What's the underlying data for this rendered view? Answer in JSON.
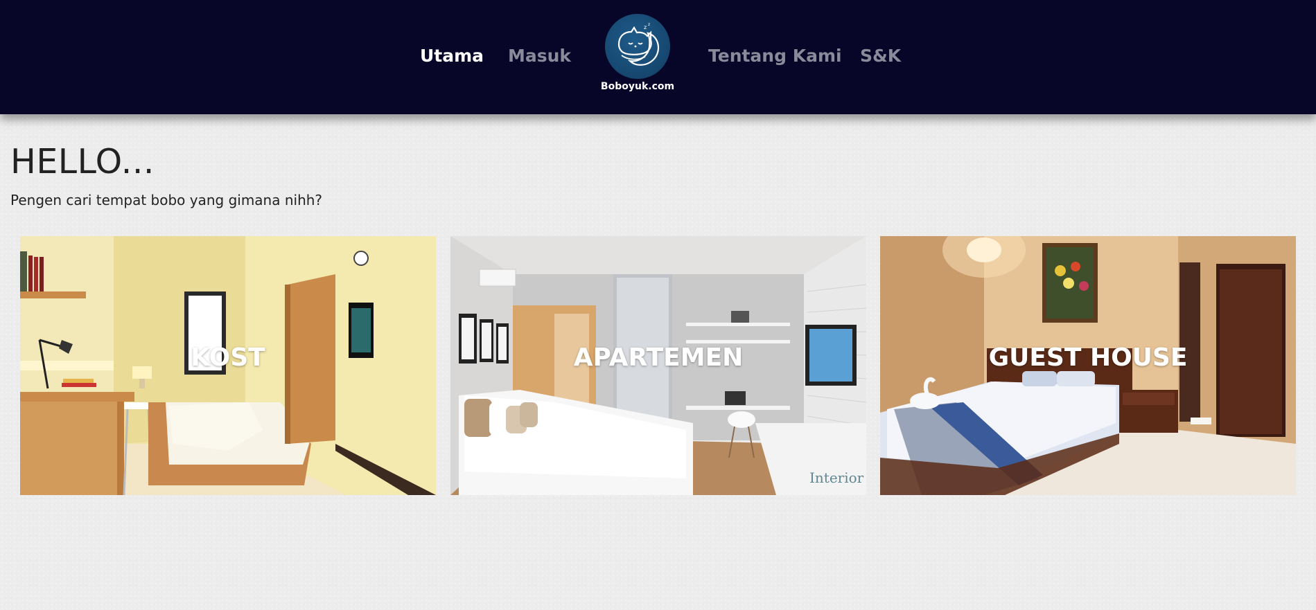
{
  "nav": {
    "links": [
      {
        "label": "Utama",
        "active": true
      },
      {
        "label": "Masuk",
        "active": false
      },
      {
        "label": "Tentang Kami",
        "active": false
      },
      {
        "label": "S&K",
        "active": false
      }
    ],
    "brand": "Boboyuk.com",
    "logo_icon": "sleeping-cat-logo-icon",
    "colors": {
      "background": "#080628",
      "active": "#ffffff",
      "inactive": "#8a8a9a",
      "logo": "#174a73"
    }
  },
  "hero": {
    "title": "HELLO...",
    "subtitle": "Pengen cari tempat bobo yang gimana nihh?"
  },
  "cards": [
    {
      "label": "KOST",
      "image": "kost-room-photo"
    },
    {
      "label": "APARTEMEN",
      "image": "apartment-room-photo"
    },
    {
      "label": "GUEST HOUSE",
      "image": "guest-house-room-photo"
    }
  ],
  "watermark": "Interior Design"
}
